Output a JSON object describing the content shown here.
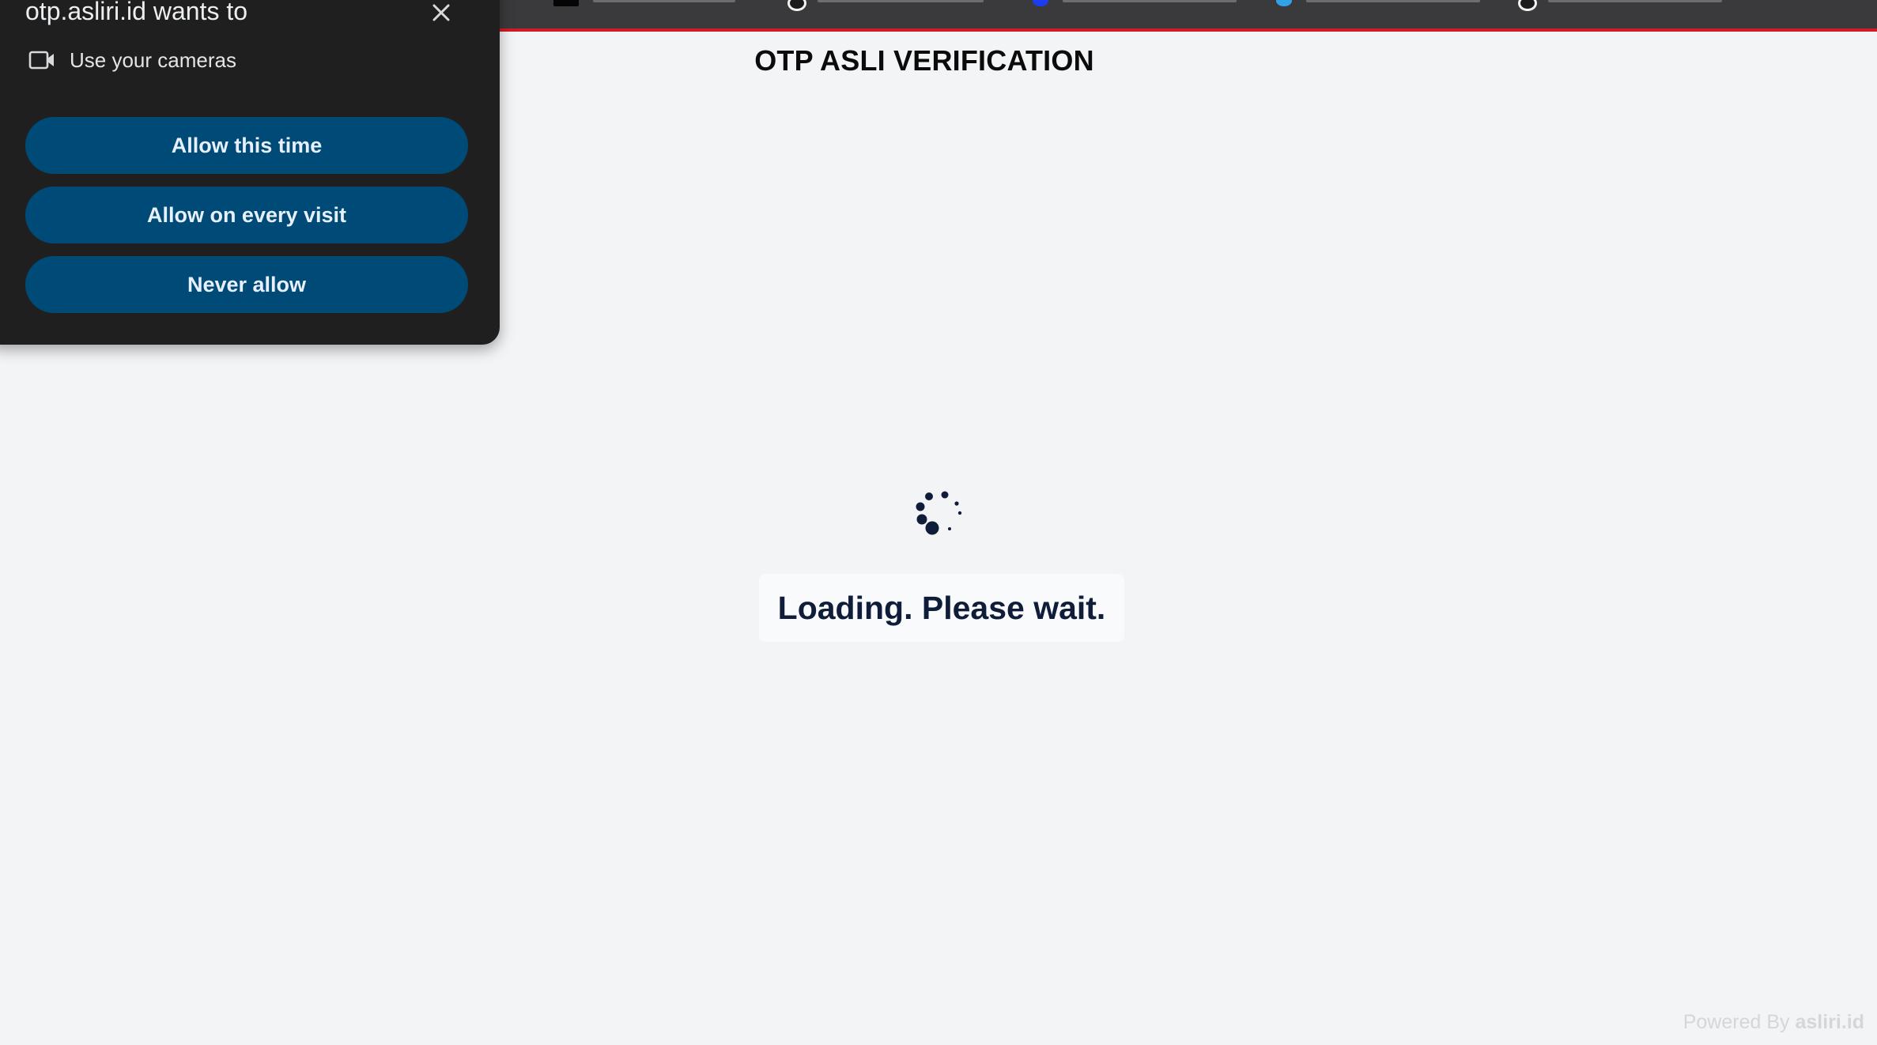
{
  "browser": {
    "accent_color": "#d11b24"
  },
  "page": {
    "title": "OTP ASLI VERIFICATION",
    "loading_text": "Loading. Please wait.",
    "powered_prefix": "Powered By",
    "powered_brand": "asliri.id"
  },
  "permission_prompt": {
    "title": "otp.asliri.id wants to",
    "close_icon": "close-icon",
    "permission_icon": "video-camera-icon",
    "permission_label": "Use your cameras",
    "buttons": {
      "allow_once": "Allow this time",
      "allow_always": "Allow on every visit",
      "never": "Never allow"
    },
    "button_color": "#004a77"
  },
  "spinner_icon": "loading-spinner-icon"
}
